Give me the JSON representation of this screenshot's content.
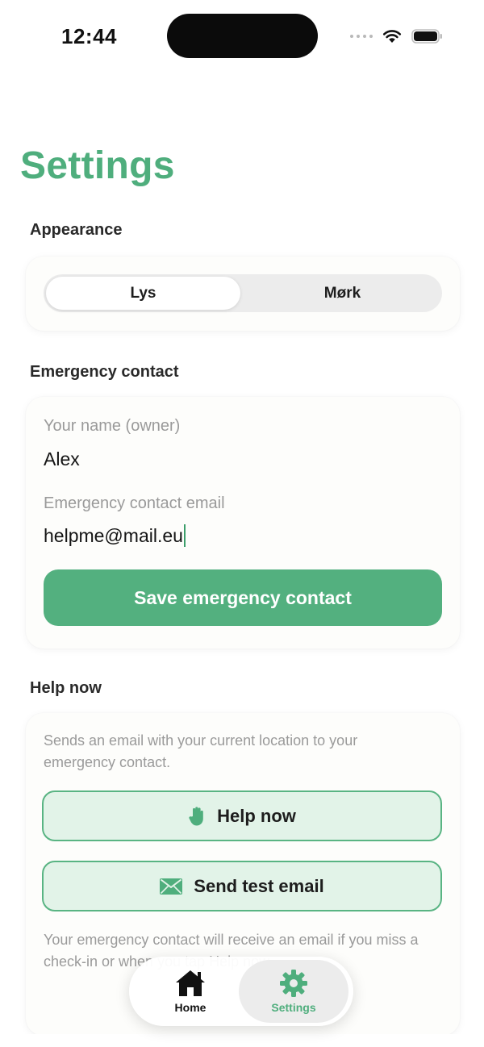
{
  "status_bar": {
    "time": "12:44",
    "icons": [
      "signal-dots-icon",
      "wifi-icon",
      "battery-icon"
    ]
  },
  "page": {
    "title": "Settings"
  },
  "appearance": {
    "section_label": "Appearance",
    "options": [
      {
        "label": "Lys",
        "selected": true
      },
      {
        "label": "Mørk",
        "selected": false
      }
    ]
  },
  "emergency_contact": {
    "section_label": "Emergency contact",
    "name_label": "Your name (owner)",
    "name_value": "Alex",
    "email_label": "Emergency contact email",
    "email_value": "helpme@mail.eu",
    "save_label": "Save emergency contact"
  },
  "help_now": {
    "section_label": "Help now",
    "description": "Sends an email with your current location to your emergency contact.",
    "help_button_label": "Help now",
    "test_button_label": "Send test email",
    "footer_text": "Your emergency contact will receive an email if you miss a check-in or when you tap Help now."
  },
  "tab_bar": {
    "tabs": [
      {
        "label": "Home",
        "icon": "house-icon",
        "active": false
      },
      {
        "label": "Settings",
        "icon": "gear-icon",
        "active": true
      }
    ]
  },
  "colors": {
    "accent": "#4fae7d",
    "button_fill": "#53b07f",
    "soft_button_fill": "#e2f3e8",
    "soft_button_border": "#59b483"
  }
}
